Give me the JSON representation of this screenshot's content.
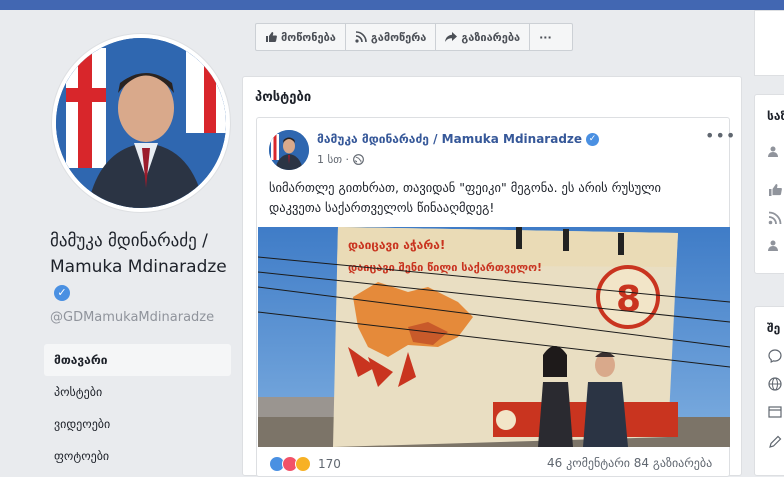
{
  "profile": {
    "name": "მამუკა მდინარაძე / Mamuka Mdinaradze",
    "handle": "@GDMamukaMdinaradze"
  },
  "nav": [
    {
      "label": "მთავარი",
      "active": true
    },
    {
      "label": "პოსტები",
      "active": false
    },
    {
      "label": "ვიდეოები",
      "active": false
    },
    {
      "label": "ფოტოები",
      "active": false
    }
  ],
  "actions": {
    "like": "მოწონება",
    "follow": "გამოწერა",
    "share": "გაზიარება",
    "more": "···"
  },
  "posts_section": {
    "title": "პოსტები"
  },
  "post": {
    "author": "მამუკა მდინარაძე / Mamuka Mdinaradze",
    "time": "1 სთ ·",
    "text": "სიმართლე გითხრათ, თავიდან \"ფეიკი\" მეგონა. ეს არის რუსული დაკვეთა საქართველოს წინააღმდეგ!",
    "menu": "•••",
    "image": {
      "billboard_line1": "დაიცავი აჭარა!",
      "billboard_line2": "დაიცავი შენი წილი საქართველო!",
      "number": "8"
    },
    "reactions_count": "170",
    "comments_shares": "46 კომენტარი  84 გაზიარება"
  },
  "right": {
    "card1_heading": "საზ",
    "card2_heading": "შე"
  }
}
